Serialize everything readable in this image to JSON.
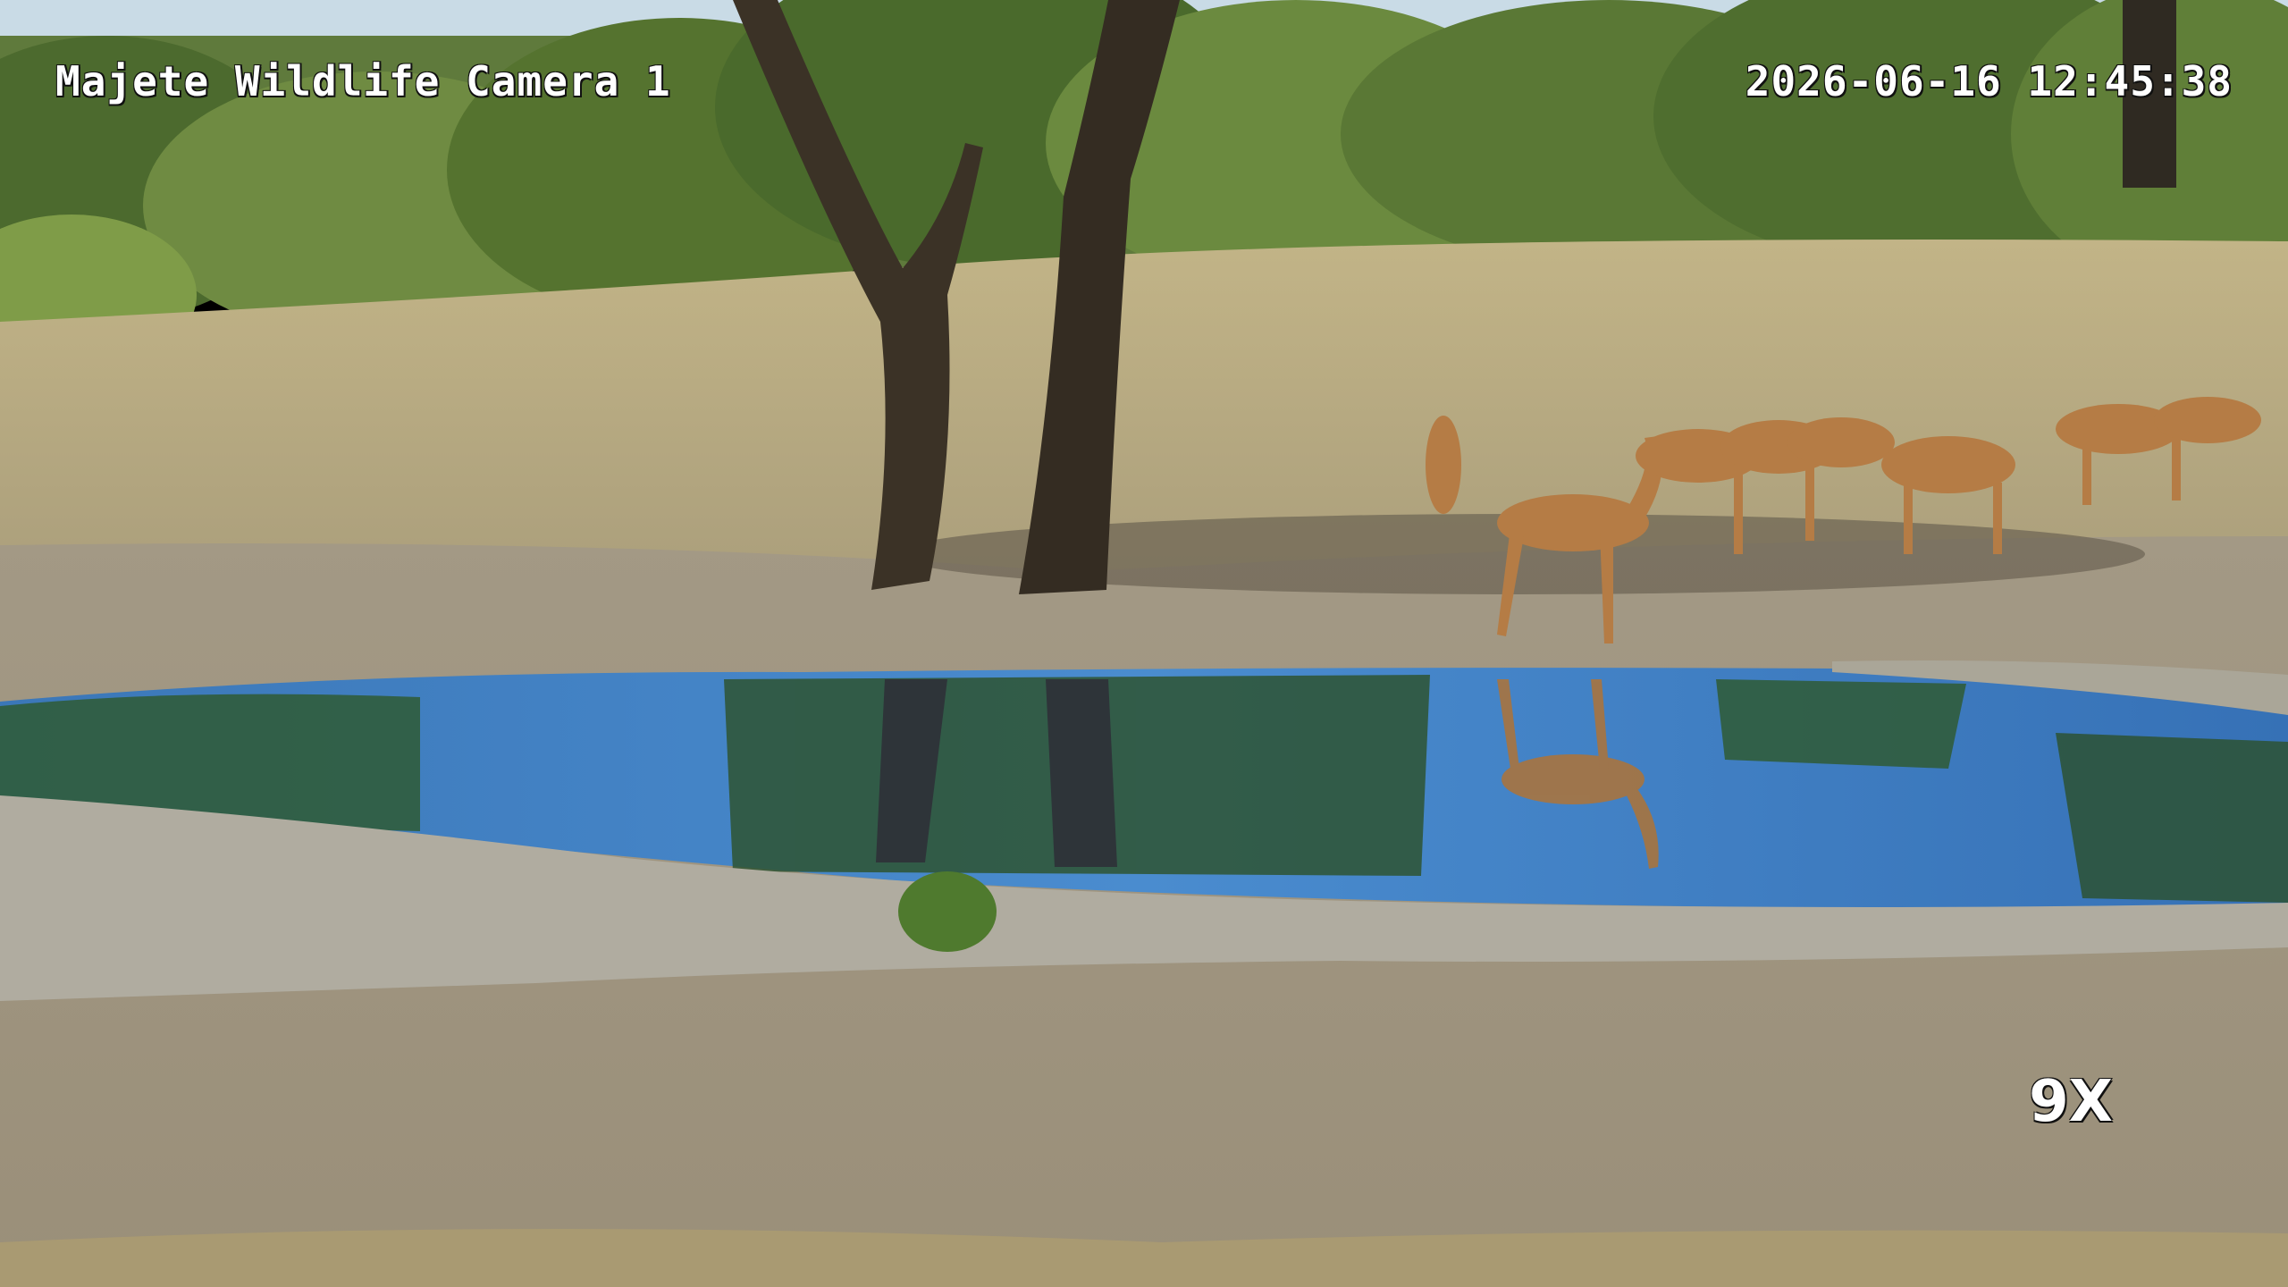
{
  "overlay": {
    "camera_name": "Majete Wildlife Camera 1",
    "timestamp": "2026-06-16 12:45:38",
    "zoom": "9X"
  },
  "scene": {
    "subject": "impala herd at waterhole",
    "colors": {
      "sky": "#c9dbe6",
      "foliage_dark": "#3f5a2a",
      "foliage_light": "#7e9a4a",
      "grass": "#b7a87c",
      "ground": "#a49a86",
      "water": "#3d7fc6",
      "water_light": "#6aa3db",
      "rock": "#b0aca0",
      "trunk": "#3b3226",
      "impala": "#b57c45",
      "shadow": "#5b5345"
    }
  }
}
